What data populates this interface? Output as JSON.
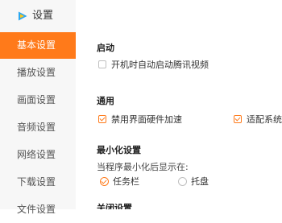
{
  "app": {
    "title": "设置",
    "logo_icon": "play-triangle-logo-icon",
    "accent_color": "#ff7a1a"
  },
  "sidebar": {
    "items": [
      {
        "label": "基本设置",
        "active": true
      },
      {
        "label": "播放设置",
        "active": false
      },
      {
        "label": "画面设置",
        "active": false
      },
      {
        "label": "音频设置",
        "active": false
      },
      {
        "label": "网络设置",
        "active": false
      },
      {
        "label": "下载设置",
        "active": false
      },
      {
        "label": "文件设置",
        "active": false
      }
    ]
  },
  "content": {
    "startup": {
      "title": "启动",
      "auto_start_label": "开机时自动启动腾讯视频",
      "auto_start_checked": false
    },
    "general": {
      "title": "通用",
      "disable_hw_accel_label": "禁用界面硬件加速",
      "disable_hw_accel_checked": true,
      "adapt_system_label": "适配系统",
      "adapt_system_checked": true
    },
    "minimize": {
      "title": "最小化设置",
      "description": "当程序最小化后显示在:",
      "options": [
        {
          "label": "任务栏",
          "selected": true
        },
        {
          "label": "托盘",
          "selected": false
        }
      ]
    },
    "close": {
      "title": "关闭设置"
    }
  }
}
